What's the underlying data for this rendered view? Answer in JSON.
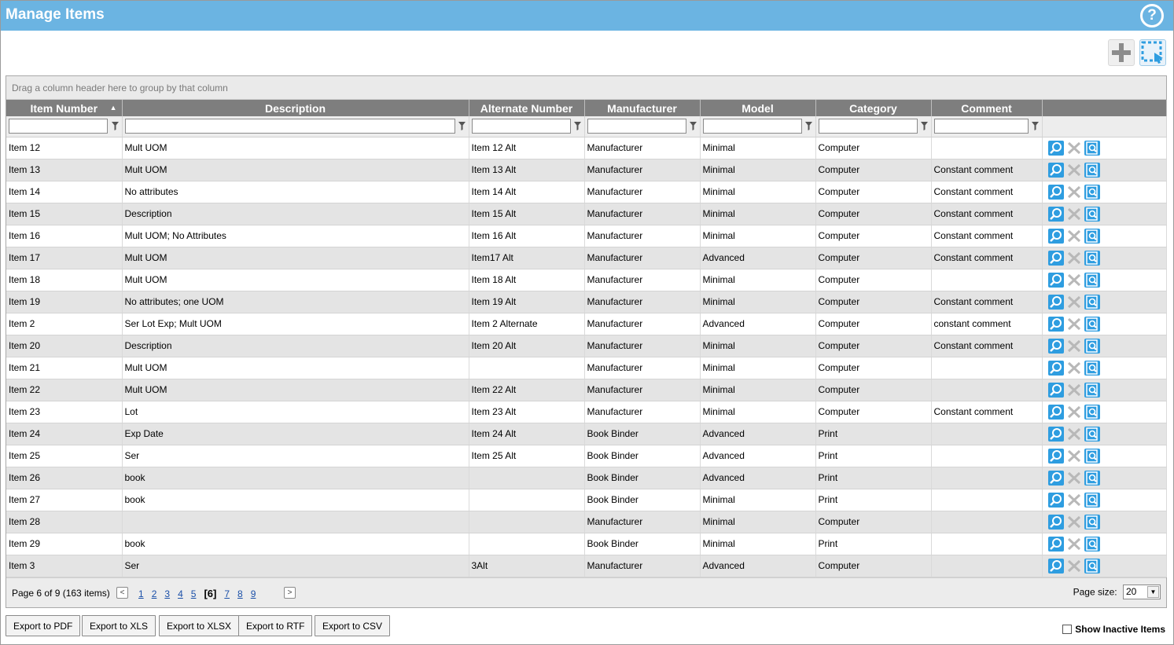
{
  "header": {
    "title": "Manage Items",
    "help_icon": "?"
  },
  "toolbar": {
    "add_icon": "plus-icon",
    "select_icon": "selection-icon"
  },
  "grid": {
    "group_panel_text": "Drag a column header here to group by that column",
    "columns": [
      "Item Number",
      "Description",
      "Alternate Number",
      "Manufacturer",
      "Model",
      "Category",
      "Comment"
    ],
    "rows": [
      [
        "Item 12",
        "Mult UOM",
        "Item 12 Alt",
        "Manufacturer",
        "Minimal",
        "Computer",
        ""
      ],
      [
        "Item 13",
        "Mult UOM",
        "Item 13 Alt",
        "Manufacturer",
        "Minimal",
        "Computer",
        "Constant comment"
      ],
      [
        "Item 14",
        "No attributes",
        "Item 14 Alt",
        "Manufacturer",
        "Minimal",
        "Computer",
        "Constant comment"
      ],
      [
        "Item 15",
        "Description",
        "Item 15 Alt",
        "Manufacturer",
        "Minimal",
        "Computer",
        "Constant comment"
      ],
      [
        "Item 16",
        "Mult UOM; No Attributes",
        "Item 16 Alt",
        "Manufacturer",
        "Minimal",
        "Computer",
        "Constant comment"
      ],
      [
        "Item 17",
        "Mult UOM",
        "Item17 Alt",
        "Manufacturer",
        "Advanced",
        "Computer",
        "Constant comment"
      ],
      [
        "Item 18",
        "Mult UOM",
        "Item 18 Alt",
        "Manufacturer",
        "Minimal",
        "Computer",
        ""
      ],
      [
        "Item 19",
        "No attributes; one UOM",
        "Item 19 Alt",
        "Manufacturer",
        "Minimal",
        "Computer",
        "Constant comment"
      ],
      [
        "Item 2",
        "Ser Lot Exp; Mult UOM",
        "Item 2 Alternate",
        "Manufacturer",
        "Advanced",
        "Computer",
        "constant comment"
      ],
      [
        "Item 20",
        "Description",
        "Item 20 Alt",
        "Manufacturer",
        "Minimal",
        "Computer",
        "Constant comment"
      ],
      [
        "Item 21",
        "Mult UOM",
        "",
        "Manufacturer",
        "Minimal",
        "Computer",
        ""
      ],
      [
        "Item 22",
        "Mult UOM",
        "Item 22 Alt",
        "Manufacturer",
        "Minimal",
        "Computer",
        ""
      ],
      [
        "Item 23",
        "Lot",
        "Item 23 Alt",
        "Manufacturer",
        "Minimal",
        "Computer",
        "Constant comment"
      ],
      [
        "Item 24",
        "Exp Date",
        "Item 24 Alt",
        "Book Binder",
        "Advanced",
        "Print",
        ""
      ],
      [
        "Item 25",
        "Ser",
        "Item 25 Alt",
        "Book Binder",
        "Advanced",
        "Print",
        ""
      ],
      [
        "Item 26",
        "book",
        "",
        "Book Binder",
        "Advanced",
        "Print",
        ""
      ],
      [
        "Item 27",
        "book",
        "",
        "Book Binder",
        "Minimal",
        "Print",
        ""
      ],
      [
        "Item 28",
        "",
        "",
        "Manufacturer",
        "Minimal",
        "Computer",
        ""
      ],
      [
        "Item 29",
        "book",
        "",
        "Book Binder",
        "Minimal",
        "Print",
        ""
      ],
      [
        "Item 3",
        "Ser",
        "3Alt",
        "Manufacturer",
        "Advanced",
        "Computer",
        ""
      ]
    ]
  },
  "pager": {
    "info": "Page 6 of 9 (163 items)",
    "prev": "<",
    "next": ">",
    "pages": [
      "1",
      "2",
      "3",
      "4",
      "5",
      "[6]",
      "7",
      "8",
      "9"
    ],
    "current_index": 5,
    "page_size_label": "Page size:",
    "page_size_value": "20"
  },
  "export": [
    "Export to PDF",
    "Export to XLS",
    "Export to XLSX",
    "Export to RTF",
    "Export to CSV"
  ],
  "show_inactive_label": "Show Inactive Items",
  "colors": {
    "title_bar": "#6bb4e2",
    "header_bg": "#7e7e7e",
    "action_blue": "#2e9de0"
  }
}
